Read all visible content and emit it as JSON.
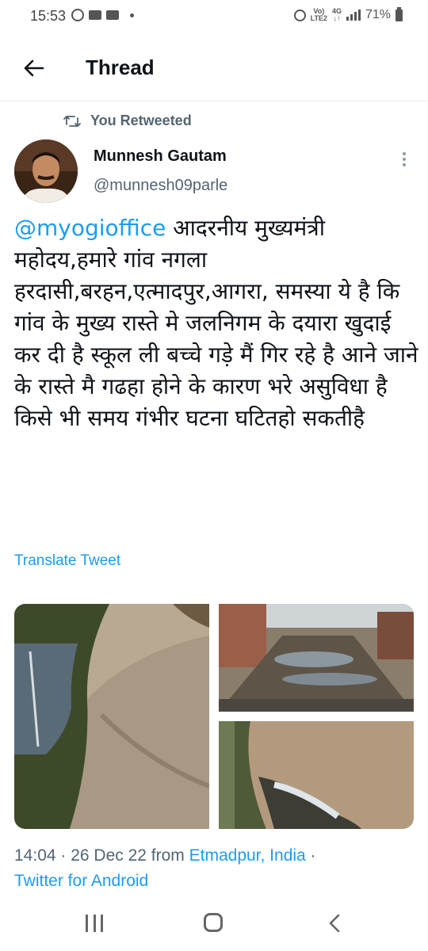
{
  "status_bar": {
    "time": "15:53",
    "network_top": "Vo)",
    "network_bottom": "LTE2",
    "gen_top": "4G",
    "gen_bottom": "↓↑",
    "battery": "71%"
  },
  "header": {
    "title": "Thread"
  },
  "retweet": {
    "label": "You Retweeted"
  },
  "author": {
    "name": "Munnesh Gautam",
    "handle": "@munnesh09parle"
  },
  "tweet": {
    "mention": "@myogioffice",
    "text": " आदरनीय मुख्यमंत्री महोदय,हमारे गांव नगला हरदासी,बरहन,एत्मादपुर,आगरा, समस्या ये है कि गांव के मुख्य रास्ते मे जलनिगम के दयारा खुदाई कर दी है स्कूल ली बच्चे गड़े मैं गिर रहे है आने जाने के रास्ते मै गढहा होने के कारण भरे असुविधा है किसे भी समय गंभीर घटना घटितहो सकतीहै",
    "translate_label": "Translate Tweet"
  },
  "meta": {
    "time_date": "14:04 · 26 Dec 22 from ",
    "location": "Etmadpur, India",
    "separator": " ·",
    "client": "Twitter for Android"
  },
  "colors": {
    "accent": "#1d9bf0",
    "secondary_text": "#536471",
    "primary_text": "#0f1419"
  },
  "icons": {
    "back": "arrow-left-icon",
    "retweet": "retweet-icon",
    "more": "more-vertical-icon",
    "nav_recent": "recent-apps-icon",
    "nav_home": "home-icon",
    "nav_back": "chevron-left-icon"
  }
}
